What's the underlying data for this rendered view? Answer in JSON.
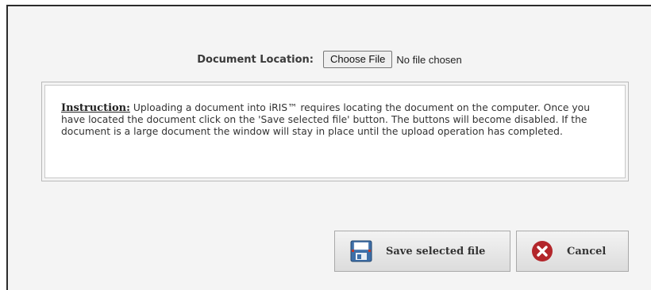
{
  "file_picker": {
    "label": "Document Location:",
    "button_label": "Choose File",
    "status": "No file chosen"
  },
  "instruction": {
    "heading": "Instruction:",
    "text": " Uploading a document into iRIS™ requires locating the document on the computer. Once you have located the document click on the 'Save selected file' button. The buttons will become disabled. If the document is a large document the window will stay in place until the upload operation has completed."
  },
  "actions": {
    "save_label": "Save selected file",
    "save_icon": "floppy-disk-icon",
    "cancel_label": "Cancel",
    "cancel_icon": "red-x-icon"
  },
  "colors": {
    "dialog_bg": "#f4f4f4",
    "cancel_icon": "#b3262b",
    "save_icon": "#3a6ea5"
  }
}
